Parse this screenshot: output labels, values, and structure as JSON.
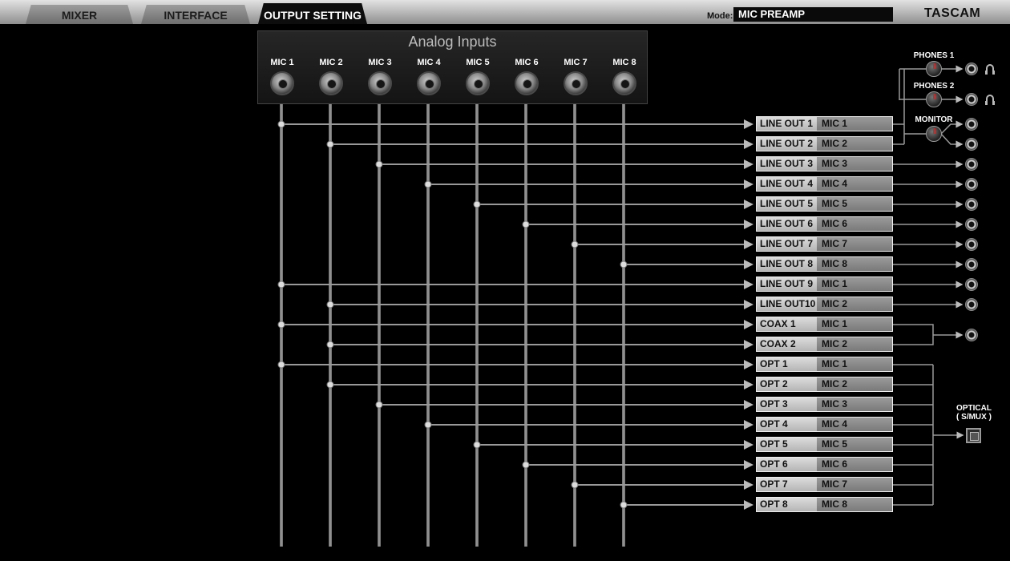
{
  "tabs": [
    {
      "label": "MIXER",
      "active": false
    },
    {
      "label": "INTERFACE",
      "active": false
    },
    {
      "label": "OUTPUT SETTING",
      "active": true
    }
  ],
  "mode": {
    "label": "Mode:",
    "value": "MIC PREAMP"
  },
  "brand": "TASCAM",
  "analog_inputs": {
    "title": "Analog Inputs",
    "inputs": [
      "MIC 1",
      "MIC 2",
      "MIC 3",
      "MIC 4",
      "MIC 5",
      "MIC 6",
      "MIC 7",
      "MIC 8"
    ]
  },
  "outputs": [
    {
      "name": "LINE OUT 1",
      "source": "MIC 1"
    },
    {
      "name": "LINE OUT 2",
      "source": "MIC 2"
    },
    {
      "name": "LINE OUT 3",
      "source": "MIC 3"
    },
    {
      "name": "LINE OUT 4",
      "source": "MIC 4"
    },
    {
      "name": "LINE OUT 5",
      "source": "MIC 5"
    },
    {
      "name": "LINE OUT 6",
      "source": "MIC 6"
    },
    {
      "name": "LINE OUT 7",
      "source": "MIC 7"
    },
    {
      "name": "LINE OUT 8",
      "source": "MIC 8"
    },
    {
      "name": "LINE OUT 9",
      "source": "MIC 1"
    },
    {
      "name": "LINE OUT10",
      "source": "MIC 2"
    },
    {
      "name": "COAX 1",
      "source": "MIC 1"
    },
    {
      "name": "COAX 2",
      "source": "MIC 2"
    },
    {
      "name": "OPT 1",
      "source": "MIC 1"
    },
    {
      "name": "OPT 2",
      "source": "MIC 2"
    },
    {
      "name": "OPT 3",
      "source": "MIC 3"
    },
    {
      "name": "OPT 4",
      "source": "MIC 4"
    },
    {
      "name": "OPT 5",
      "source": "MIC 5"
    },
    {
      "name": "OPT 6",
      "source": "MIC 6"
    },
    {
      "name": "OPT 7",
      "source": "MIC 7"
    },
    {
      "name": "OPT 8",
      "source": "MIC 8"
    }
  ],
  "monitor_section": {
    "phones1_label": "PHONES 1",
    "phones2_label": "PHONES 2",
    "monitor_label": "MONITOR",
    "optical_label_1": "OPTICAL",
    "optical_label_2": "( S/MUX )"
  }
}
